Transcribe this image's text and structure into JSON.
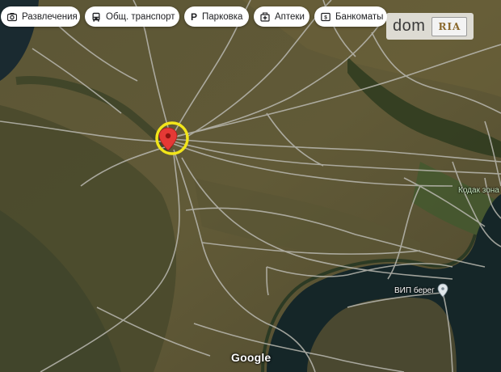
{
  "filters": [
    {
      "label": "Развлечения",
      "icon": "camera-icon"
    },
    {
      "label": "Общ. транспорт",
      "icon": "bus-icon"
    },
    {
      "label": "Парковка",
      "icon": "parking-icon"
    },
    {
      "label": "Аптеки",
      "icon": "pharmacy-icon"
    },
    {
      "label": "Банкоматы",
      "icon": "atm-icon"
    }
  ],
  "logo": {
    "main": "dom",
    "badge": "RIA"
  },
  "places": {
    "kodak": "Кодак зона",
    "vip": "ВИП берег"
  },
  "attribution": "Google",
  "colors": {
    "marker": "#e53935",
    "highlight_ring": "#f2e51a",
    "water": "#152628"
  }
}
